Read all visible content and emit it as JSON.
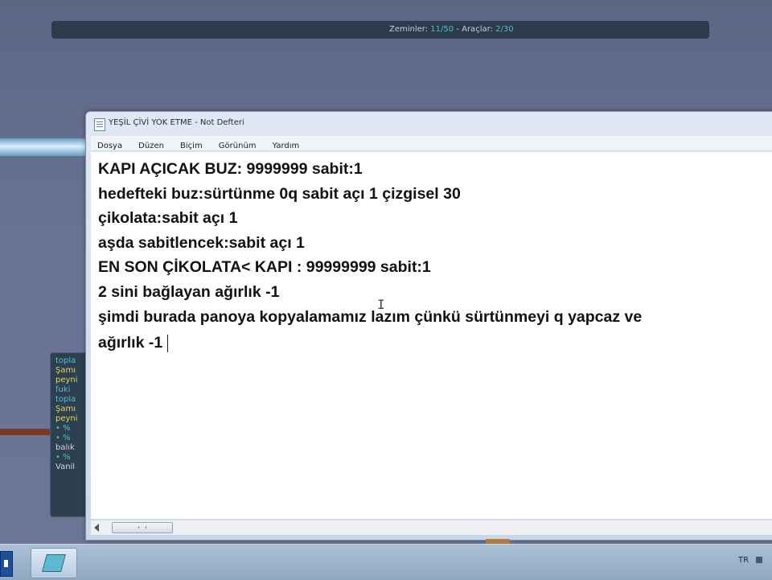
{
  "background_app": {
    "status": {
      "zeminler_label": "Zeminler:",
      "zeminler_value": "11/50",
      "sep": "-",
      "araclar_label": "Araçlar:",
      "araclar_value": "2/30"
    },
    "side_panel_lines": [
      {
        "text": "topla",
        "color": "teal"
      },
      {
        "text": "Şamı",
        "color": "yellow"
      },
      {
        "text": "peyni",
        "color": "yellow"
      },
      {
        "text": "fuki",
        "color": "teal"
      },
      {
        "text": "topla",
        "color": "teal"
      },
      {
        "text": "Şamı",
        "color": "yellow"
      },
      {
        "text": "peyni",
        "color": "yellow"
      },
      {
        "text": "• %",
        "color": "teal"
      },
      {
        "text": "• %",
        "color": "teal"
      },
      {
        "text": "balık",
        "color": "white"
      },
      {
        "text": "• %",
        "color": "teal"
      },
      {
        "text": "Vanil",
        "color": "white"
      }
    ]
  },
  "notepad": {
    "title": "YEŞİL ÇİVİ YOK ETME - Not Defteri",
    "menu": [
      "Dosya",
      "Düzen",
      "Biçim",
      "Görünüm",
      "Yardım"
    ],
    "lines": [
      "KAPI AÇICAK BUZ: 9999999 sabit:1",
      "hedefteki buz:sürtünme 0q sabit açı 1 çizgisel 30",
      "çikolata:sabit açı 1",
      "aşda sabitlencek:sabit açı 1",
      "EN SON ÇİKOLATA< KAPI : 99999999 sabit:1",
      "2 sini bağlayan ağırlık -1",
      "şimdi burada panoya kopyalamamız lazım çünkü sürtünmeyi q yapcaz ve",
      "ağırlık -1"
    ]
  },
  "taskbar": {
    "language": "TR"
  },
  "colors": {
    "desktop": "#6a7293",
    "topbar": "#2c3a4c",
    "accent_teal": "#4fc1c9",
    "window_frame": "#c9d7e8"
  }
}
